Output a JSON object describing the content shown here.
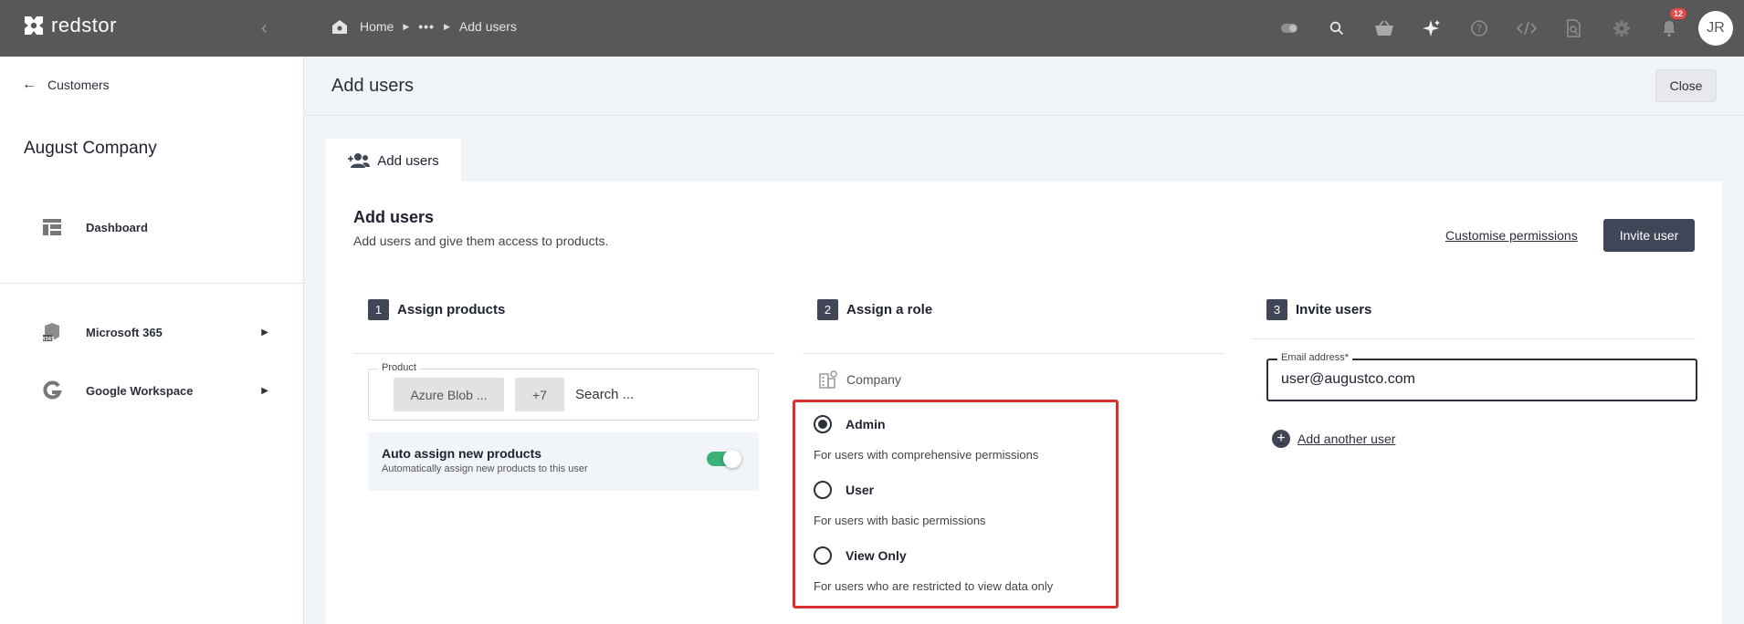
{
  "topbar": {
    "logo_text": "redstor",
    "breadcrumb": {
      "home": "Home",
      "ellipsis": "•••",
      "current": "Add users"
    },
    "notifications_count": "12",
    "avatar_initials": "JR"
  },
  "sidebar": {
    "back_label": "Customers",
    "company_name": "August Company",
    "items": [
      {
        "label": "Dashboard",
        "icon": "dashboard-icon"
      },
      {
        "label": "Microsoft 365",
        "icon": "microsoft-365-icon"
      },
      {
        "label": "Google Workspace",
        "icon": "google-icon"
      }
    ]
  },
  "header": {
    "title": "Add users",
    "close_label": "Close"
  },
  "tab": {
    "label": "Add users"
  },
  "panel": {
    "title": "Add users",
    "subtitle": "Add users and give them access to products.",
    "customise_label": "Customise permissions",
    "invite_label": "Invite user"
  },
  "step1": {
    "number": "1",
    "title": "Assign products",
    "product_label": "Product",
    "chip_selected": "Azure Blob ...",
    "chip_more": "+7",
    "search_placeholder": "Search ...",
    "auto_title": "Auto assign new products",
    "auto_sub": "Automatically assign new products to this user",
    "auto_enabled": true
  },
  "step2": {
    "number": "2",
    "title": "Assign a role",
    "company_label": "Company",
    "roles": [
      {
        "name": "Admin",
        "desc": "For users with comprehensive permissions",
        "selected": true
      },
      {
        "name": "User",
        "desc": "For users with basic permissions",
        "selected": false
      },
      {
        "name": "View Only",
        "desc": "For users who are restricted to view data only",
        "selected": false
      }
    ]
  },
  "step3": {
    "number": "3",
    "title": "Invite users",
    "email_label": "Email address*",
    "email_value": "user@augustco.com",
    "add_another_label": "Add another user"
  },
  "colors": {
    "topbar": "#585858",
    "primary_button": "#414558",
    "highlight": "#d8312f",
    "toggle_on": "#3bb077"
  }
}
